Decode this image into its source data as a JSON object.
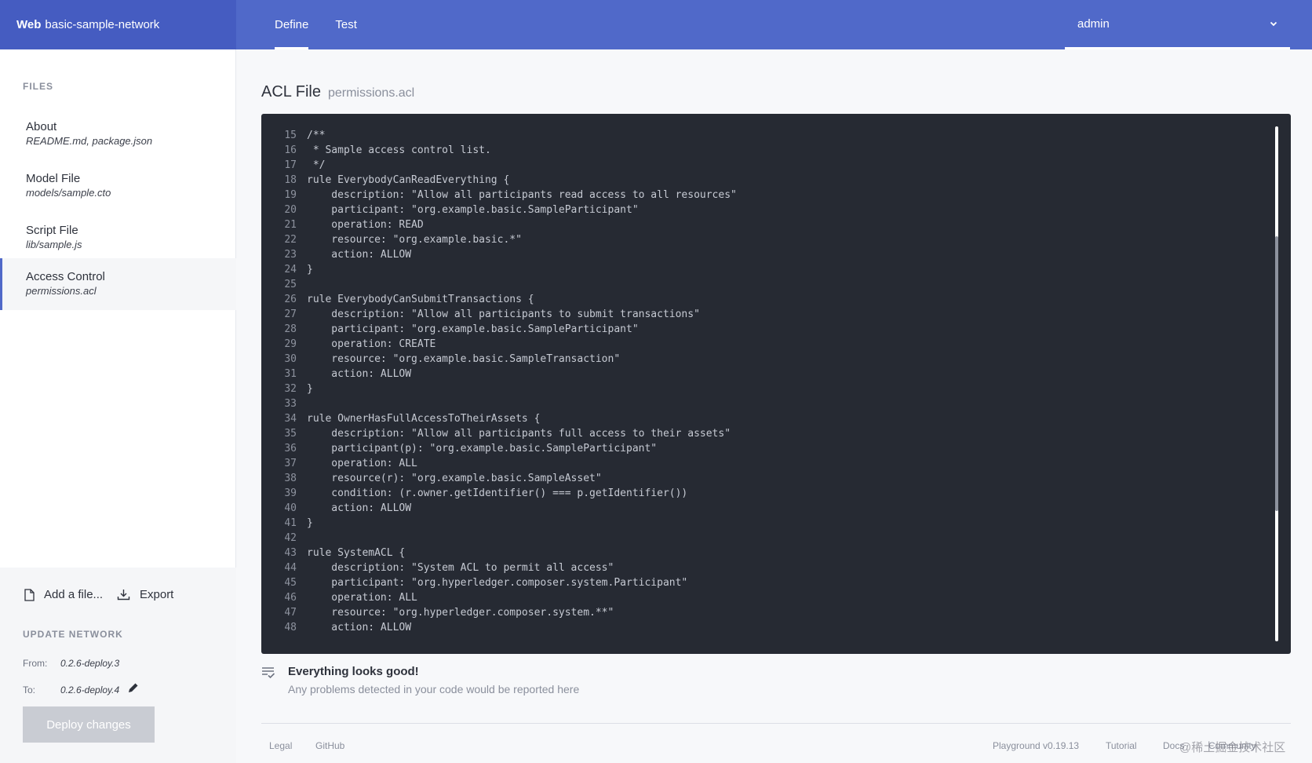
{
  "header": {
    "brand_bold": "Web",
    "brand_name": "basic-sample-network",
    "tabs": [
      {
        "label": "Define"
      },
      {
        "label": "Test"
      }
    ],
    "user": "admin"
  },
  "sidebar": {
    "files_label": "FILES",
    "items": [
      {
        "title": "About",
        "sub": "README.md, package.json"
      },
      {
        "title": "Model File",
        "sub": "models/sample.cto"
      },
      {
        "title": "Script File",
        "sub": "lib/sample.js"
      },
      {
        "title": "Access Control",
        "sub": "permissions.acl"
      }
    ],
    "add_file": "Add a file...",
    "export": "Export",
    "update_label": "UPDATE NETWORK",
    "from_label": "From:",
    "from_value": "0.2.6-deploy.3",
    "to_label": "To:",
    "to_value": "0.2.6-deploy.4",
    "deploy_label": "Deploy changes"
  },
  "main": {
    "file_title": "ACL File",
    "file_name": "permissions.acl",
    "code_lines": [
      {
        "n": "15",
        "t": "/**"
      },
      {
        "n": "16",
        "t": " * Sample access control list."
      },
      {
        "n": "17",
        "t": " */"
      },
      {
        "n": "18",
        "t": "rule EverybodyCanReadEverything {"
      },
      {
        "n": "19",
        "t": "    description: \"Allow all participants read access to all resources\""
      },
      {
        "n": "20",
        "t": "    participant: \"org.example.basic.SampleParticipant\""
      },
      {
        "n": "21",
        "t": "    operation: READ"
      },
      {
        "n": "22",
        "t": "    resource: \"org.example.basic.*\""
      },
      {
        "n": "23",
        "t": "    action: ALLOW"
      },
      {
        "n": "24",
        "t": "}"
      },
      {
        "n": "25",
        "t": ""
      },
      {
        "n": "26",
        "t": "rule EverybodyCanSubmitTransactions {"
      },
      {
        "n": "27",
        "t": "    description: \"Allow all participants to submit transactions\""
      },
      {
        "n": "28",
        "t": "    participant: \"org.example.basic.SampleParticipant\""
      },
      {
        "n": "29",
        "t": "    operation: CREATE"
      },
      {
        "n": "30",
        "t": "    resource: \"org.example.basic.SampleTransaction\""
      },
      {
        "n": "31",
        "t": "    action: ALLOW"
      },
      {
        "n": "32",
        "t": "}"
      },
      {
        "n": "33",
        "t": ""
      },
      {
        "n": "34",
        "t": "rule OwnerHasFullAccessToTheirAssets {"
      },
      {
        "n": "35",
        "t": "    description: \"Allow all participants full access to their assets\""
      },
      {
        "n": "36",
        "t": "    participant(p): \"org.example.basic.SampleParticipant\""
      },
      {
        "n": "37",
        "t": "    operation: ALL"
      },
      {
        "n": "38",
        "t": "    resource(r): \"org.example.basic.SampleAsset\""
      },
      {
        "n": "39",
        "t": "    condition: (r.owner.getIdentifier() === p.getIdentifier())"
      },
      {
        "n": "40",
        "t": "    action: ALLOW"
      },
      {
        "n": "41",
        "t": "}"
      },
      {
        "n": "42",
        "t": ""
      },
      {
        "n": "43",
        "t": "rule SystemACL {"
      },
      {
        "n": "44",
        "t": "    description: \"System ACL to permit all access\""
      },
      {
        "n": "45",
        "t": "    participant: \"org.hyperledger.composer.system.Participant\""
      },
      {
        "n": "46",
        "t": "    operation: ALL"
      },
      {
        "n": "47",
        "t": "    resource: \"org.hyperledger.composer.system.**\""
      },
      {
        "n": "48",
        "t": "    action: ALLOW"
      }
    ],
    "status_title": "Everything looks good!",
    "status_sub": "Any problems detected in your code would be reported here"
  },
  "footer": {
    "legal": "Legal",
    "github": "GitHub",
    "version": "Playground v0.19.13",
    "tutorial": "Tutorial",
    "docs": "Docs",
    "community": "Community",
    "watermark": "@稀土掘金技术社区"
  }
}
